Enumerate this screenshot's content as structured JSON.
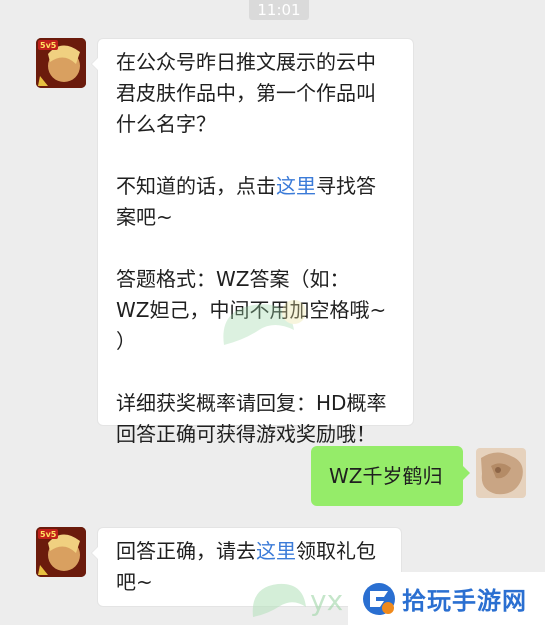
{
  "header": {
    "time": "11:01"
  },
  "messages": [
    {
      "sender": "bot",
      "paragraphs": {
        "p1_l1": "在公众号昨日推文展示的云中",
        "p1_l2": "君皮肤作品中，第一个作品叫",
        "p1_l3": "什么名字？",
        "p2_l1_pre": "不知道的话，点击",
        "p2_l1_link": "这里",
        "p2_l1_post": "寻找答",
        "p2_l2": "案吧~",
        "p3_l1": "答题格式：WZ答案（如：",
        "p3_l2": "WZ妲己，中间不用加空格哦~",
        "p3_l3": "）",
        "p4_l1": "详细获奖概率请回复：HD概率",
        "p4_l2": "回答正确可获得游戏奖励哦！"
      },
      "avatar_icon": "game-avatar-icon"
    },
    {
      "sender": "user",
      "text": "WZ千岁鹤归",
      "avatar_icon": "user-avatar-icon"
    },
    {
      "sender": "bot",
      "paragraphs": {
        "l1_pre": "回答正确，请去",
        "l1_link": "这里",
        "l1_post": "领取礼包",
        "l2": "吧~"
      },
      "avatar_icon": "game-avatar-icon"
    }
  ],
  "watermark": {
    "brand": "拾玩手游网",
    "icon": "brand-logo-icon"
  },
  "colors": {
    "link": "#3b7bd8",
    "user_bubble": "#95ec69",
    "background": "#ededed"
  }
}
